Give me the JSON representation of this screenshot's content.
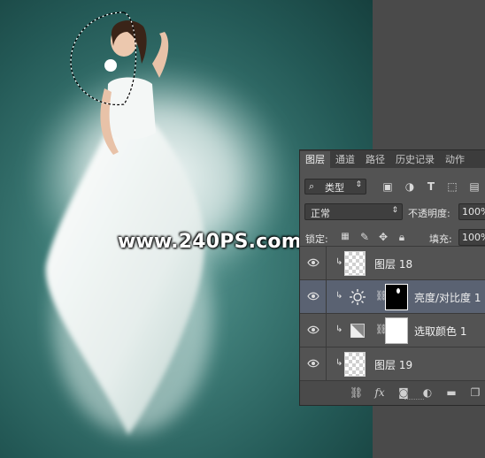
{
  "watermark": "www.240PS.com",
  "panel": {
    "tabs": [
      "图层",
      "通道",
      "路径",
      "历史记录",
      "动作"
    ],
    "filter_kind": "类型",
    "blend_mode": "正常",
    "opacity_label": "不透明度:",
    "opacity_value": "100%",
    "lock_label": "锁定:",
    "fill_label": "填充:",
    "fill_value": "100%",
    "layers": [
      {
        "name": "图层 18",
        "type": "pixel",
        "clipped": true,
        "visible": true,
        "selected": false
      },
      {
        "name": "亮度/对比度 1",
        "type": "brightness-contrast",
        "clipped": true,
        "visible": true,
        "selected": true
      },
      {
        "name": "选取颜色 1",
        "type": "selective-color",
        "clipped": true,
        "visible": true,
        "selected": false
      },
      {
        "name": "图层 19",
        "type": "pixel",
        "clipped": true,
        "visible": true,
        "selected": false
      }
    ]
  },
  "colors": {
    "canvas_teal": "#3d7b76",
    "panel_bg": "#535353",
    "selected_layer": "#5a6272"
  }
}
